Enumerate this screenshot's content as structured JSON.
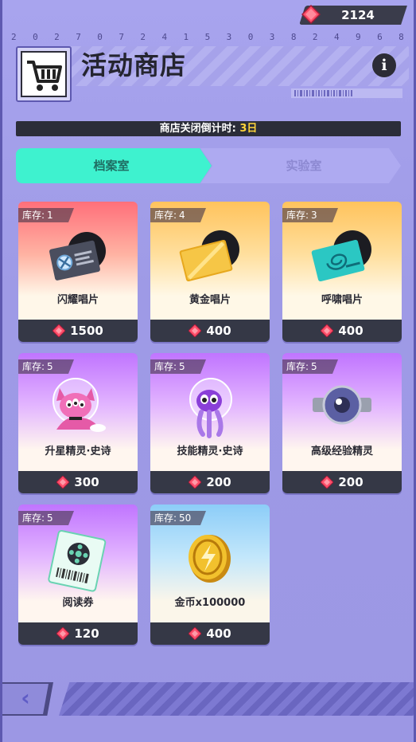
{
  "header": {
    "currency_value": "2124",
    "digits": [
      "2",
      "0",
      "2",
      "7",
      "0",
      "7",
      "2",
      "4",
      "1",
      "5",
      "3",
      "0",
      "3",
      "8",
      "2",
      "4",
      "9",
      "6",
      "8"
    ],
    "title": "活动商店",
    "info_label": "i"
  },
  "countdown": {
    "label": "商店关闭倒计时: ",
    "days": "3日"
  },
  "tabs": [
    {
      "label": "档案室",
      "active": true
    },
    {
      "label": "实验室",
      "active": false
    }
  ],
  "stock_label": "库存:",
  "items": [
    {
      "name": "闪耀唱片",
      "stock": "1",
      "price": "1500",
      "icon": "shining-record-icon",
      "bg": "red"
    },
    {
      "name": "黄金唱片",
      "stock": "4",
      "price": "400",
      "icon": "gold-record-icon",
      "bg": "gold"
    },
    {
      "name": "呼啸唱片",
      "stock": "3",
      "price": "400",
      "icon": "whistling-record-icon",
      "bg": "gold"
    },
    {
      "name": "升星精灵·史诗",
      "stock": "5",
      "price": "300",
      "icon": "star-up-sprite-icon",
      "bg": "purple"
    },
    {
      "name": "技能精灵·史诗",
      "stock": "5",
      "price": "200",
      "icon": "skill-sprite-icon",
      "bg": "purple"
    },
    {
      "name": "高级经验精灵",
      "stock": "5",
      "price": "200",
      "icon": "exp-sprite-icon",
      "bg": "purple"
    },
    {
      "name": "阅读券",
      "stock": "5",
      "price": "120",
      "icon": "reading-ticket-icon",
      "bg": "purple"
    },
    {
      "name": "金币x100000",
      "stock": "50",
      "price": "400",
      "icon": "gold-coin-icon",
      "bg": "blue"
    }
  ],
  "footer": {
    "back_label": "‹"
  },
  "colors": {
    "accent_tab": "#3ef2cf",
    "countdown_highlight": "#ffd43a",
    "gem": "#ff4f6a"
  }
}
